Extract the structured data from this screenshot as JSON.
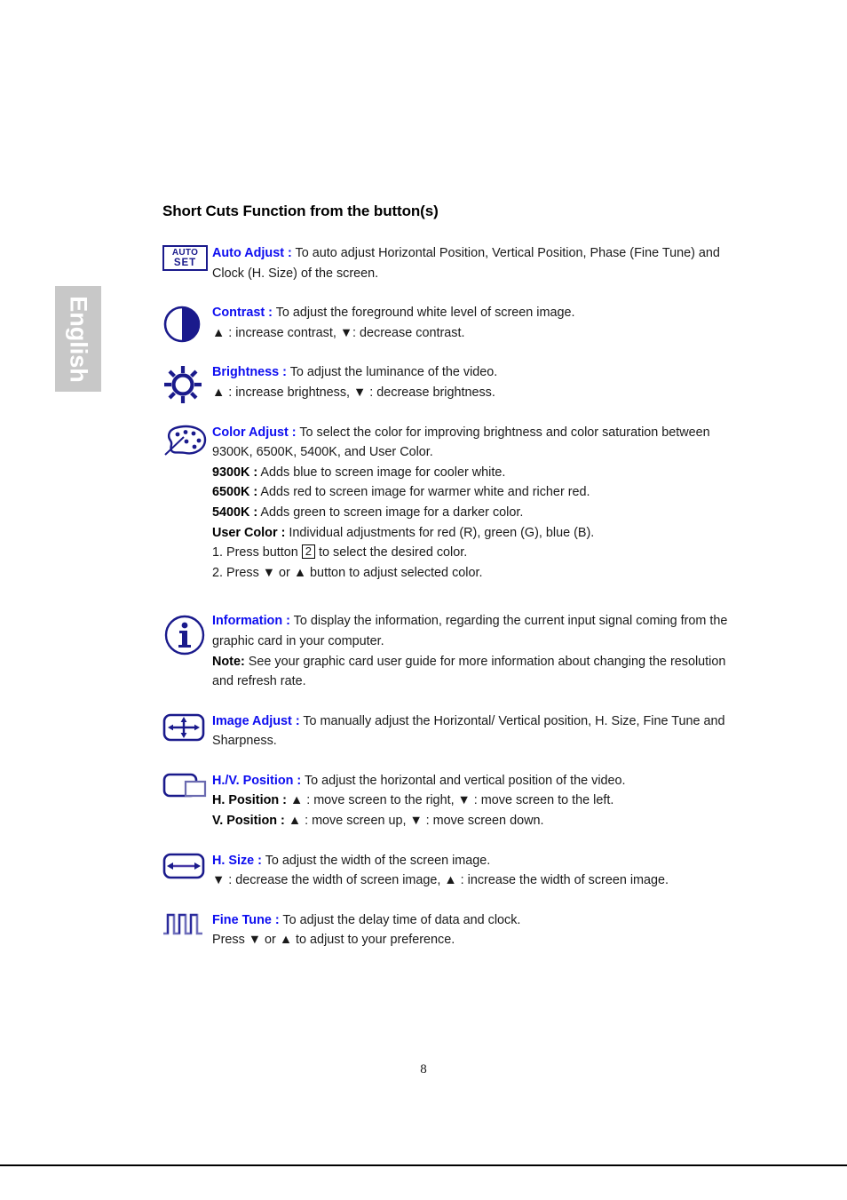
{
  "sidebar": {
    "language_tab": "English"
  },
  "page": {
    "title": "Short Cuts Function from the button(s)",
    "page_number": "8"
  },
  "colors": {
    "term_blue": "#0d0df0",
    "icon_navy": "#1a1a8c",
    "tab_gray": "#c8c8c8",
    "text_black": "#1a1a1a"
  },
  "entries": [
    {
      "id": "auto-adjust",
      "icon": "auto-set-button-icon",
      "icon_text": {
        "top": "AUTO",
        "bottom": "SET"
      },
      "term": "Auto Adjust :",
      "lines": [
        " To auto adjust Horizontal Position, Vertical Position, Phase (Fine Tune) and Clock (H. Size) of the screen."
      ]
    },
    {
      "id": "contrast",
      "icon": "contrast-half-circle-icon",
      "term": "Contrast :",
      "lines": [
        " To adjust the foreground white level of screen image.",
        "▲ : increase contrast, ▼: decrease contrast."
      ]
    },
    {
      "id": "brightness",
      "icon": "brightness-sun-icon",
      "term": "Brightness :",
      "lines": [
        " To adjust the luminance of the video.",
        "▲ : increase brightness, ▼ : decrease brightness."
      ]
    },
    {
      "id": "color-adjust",
      "icon": "color-palette-icon",
      "term": "Color Adjust :",
      "lines": [
        " To select the color for improving brightness and color saturation between 9300K, 6500K, 5400K, and User Color."
      ],
      "sub_items": [
        {
          "label": "9300K :",
          "text": " Adds blue to screen image for cooler white."
        },
        {
          "label": "6500K :",
          "text": " Adds red to screen image for warmer white and richer red."
        },
        {
          "label": "5400K :",
          "text": " Adds green to screen image for a darker color."
        },
        {
          "label": "User Color :",
          "text": " Individual adjustments for red (R), green (G), blue (B)."
        }
      ],
      "steps": {
        "step1_pre": "1. Press button ",
        "step1_key": "2",
        "step1_post": " to select the desired color.",
        "step2": "2. Press ▼ or ▲ button to adjust selected color."
      }
    },
    {
      "id": "information",
      "icon": "information-circle-icon",
      "term": "Information :",
      "lines": [
        " To display the information, regarding the current input signal coming from the graphic card in your computer."
      ],
      "note_label": "Note:",
      "note_text": " See your graphic card user guide for more information about changing the resolution and refresh rate."
    },
    {
      "id": "image-adjust",
      "icon": "image-adjust-four-way-arrow-icon",
      "term": "Image Adjust :",
      "lines": [
        " To manually adjust the Horizontal/ Vertical position, H. Size, Fine Tune and Sharpness."
      ]
    },
    {
      "id": "hv-position",
      "icon": "hv-position-offset-rectangles-icon",
      "term": "H./V. Position :",
      "lines": [
        " To adjust the horizontal and vertical position of the video."
      ],
      "sub_items": [
        {
          "label": "H. Position :",
          "text": " ▲ : move screen to the right, ▼ : move screen to the left."
        },
        {
          "label": "V. Position :",
          "text": " ▲ : move screen up, ▼ : move screen down."
        }
      ]
    },
    {
      "id": "h-size",
      "icon": "h-size-horizontal-arrow-icon",
      "term": "H. Size :",
      "lines": [
        " To adjust the width of the screen image.",
        "▼ : decrease the width of screen image, ▲ : increase the width of screen image."
      ]
    },
    {
      "id": "fine-tune",
      "icon": "fine-tune-square-wave-icon",
      "term": "Fine Tune :",
      "lines": [
        " To adjust the delay time of data and clock.",
        "Press ▼ or ▲ to adjust to your preference."
      ]
    }
  ]
}
